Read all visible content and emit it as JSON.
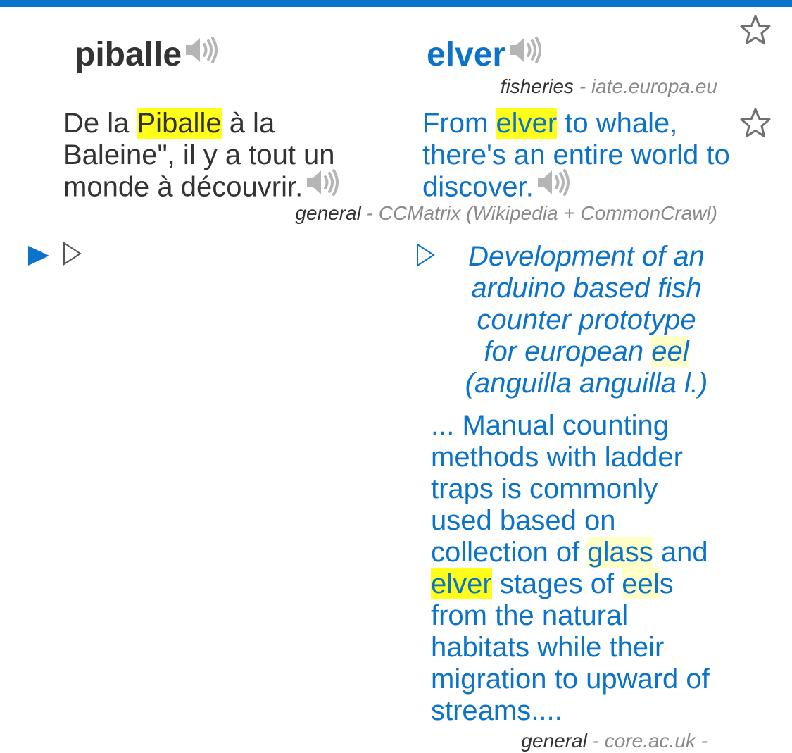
{
  "entry": {
    "fr_headword": "piballe",
    "en_headword": "elver",
    "domain": "fisheries",
    "source_sep": " - ",
    "source": "iate.europa.eu"
  },
  "example": {
    "fr_parts": [
      "De la ",
      "Piballe",
      " à la Baleine\", il y a tout un monde à découvrir."
    ],
    "en_parts": [
      "From ",
      "elver",
      " to whale, there's an entire world to discover."
    ],
    "domain": "general",
    "source_sep": " - ",
    "source": "CCMatrix (Wikipedia + CommonCrawl)"
  },
  "document": {
    "title_parts": [
      "Development of an arduino based fish counter prototype for european ",
      "eel",
      " (anguilla anguilla l.)"
    ],
    "body_parts": [
      "... Manual counting methods with ladder traps is commonly used based on collection of ",
      "glass",
      " and ",
      "elver",
      " stages of ",
      "eel",
      "s from the natural habitats while their migration to upward of streams...."
    ],
    "domain": "general",
    "source_sep": " - ",
    "source": "core.ac.uk -"
  },
  "icons": {
    "speaker": "speaker-icon",
    "star": "star-outline-icon",
    "play_filled": "play-filled-icon",
    "play_outline": "play-outline-icon"
  },
  "colors": {
    "accent": "#0b73c9",
    "text": "#333333",
    "muted": "#8a8a8a",
    "highlight": "#ffff1a",
    "highlight_light": "#ffffc8",
    "icon_gray": "#b5b5b5"
  }
}
